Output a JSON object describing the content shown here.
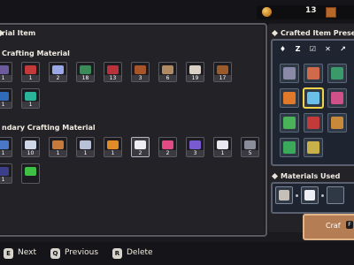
{
  "header": {
    "gold_amount": "13",
    "coin_icon": "gold-coin-icon",
    "chest_icon": "chest-icon"
  },
  "left_panel": {
    "title": "rial Item",
    "sections": [
      {
        "title": "Crafting Material",
        "rows": [
          [
            {
              "icon": "scroll-icon",
              "color": "#6c5a9c",
              "count": "1"
            },
            {
              "icon": "red-gem-icon",
              "color": "#c23a3a",
              "count": "1"
            },
            {
              "icon": "diamond-icon",
              "color": "#9aa8e8",
              "count": "2"
            },
            {
              "icon": "green-herb-icon",
              "color": "#3c8a5a",
              "count": "18"
            },
            {
              "icon": "red-crystal-icon",
              "color": "#b8323c",
              "count": "13"
            },
            {
              "icon": "spider-icon",
              "color": "#a9552a",
              "count": "3"
            },
            {
              "icon": "mushroom-icon",
              "color": "#b08a63",
              "count": "6"
            },
            {
              "icon": "bandage-icon",
              "color": "#d9d1c6",
              "count": "19"
            },
            {
              "icon": "log-icon",
              "color": "#9a5a2a",
              "count": "17"
            }
          ],
          [
            {
              "icon": "blue-flask-icon",
              "color": "#2f6bb8",
              "count": "1"
            },
            {
              "icon": "teal-potion-icon",
              "color": "#2ab59a",
              "count": "1"
            }
          ]
        ]
      },
      {
        "title": "ndary Crafting Material",
        "rows": [
          [
            {
              "icon": "blue-scale-icon",
              "color": "#4a78c9",
              "count": "1"
            },
            {
              "icon": "feather-icon",
              "color": "#cfd6e6",
              "count": "10"
            },
            {
              "icon": "hourglass-icon",
              "color": "#c77a3a",
              "count": "1"
            },
            {
              "icon": "shield-fragment-icon",
              "color": "#b7c2d6",
              "count": "1"
            },
            {
              "icon": "ankh-icon",
              "color": "#e08a2a",
              "count": "1"
            },
            {
              "icon": "white-crystal-icon",
              "color": "#f0eef5",
              "count": "2"
            },
            {
              "icon": "pink-vial-icon",
              "color": "#e24a86",
              "count": "2"
            },
            {
              "icon": "purple-cube-icon",
              "color": "#7a5ad1",
              "count": "3"
            },
            {
              "icon": "quill-icon",
              "color": "#e8e6ef",
              "count": "1"
            },
            {
              "icon": "book-icon",
              "color": "#8a8d99",
              "count": "5"
            }
          ],
          [
            {
              "icon": "dark-vial-icon",
              "color": "#3b3f8a",
              "count": "1"
            },
            {
              "icon": "green-plant-icon",
              "color": "#3fbf46",
              "count": ""
            }
          ]
        ]
      }
    ]
  },
  "right_panel": {
    "preset_title": "Crafted Item Preset",
    "tabs": [
      "♦",
      "Z",
      "☑",
      "✕",
      "↗"
    ],
    "preset_items": [
      {
        "icon": "dark-sword-icon",
        "color": "#8a8aa8",
        "selected": false
      },
      {
        "icon": "wand-icon",
        "color": "#d06a4a",
        "selected": false
      },
      {
        "icon": "green-blade-icon",
        "color": "#3a9a6a",
        "selected": false
      },
      {
        "icon": "fire-staff-icon",
        "color": "#e07a2a",
        "selected": false
      },
      {
        "icon": "ice-sword-icon",
        "color": "#6ac0e8",
        "selected": true
      },
      {
        "icon": "pink-dagger-icon",
        "color": "#d0508a",
        "selected": false
      },
      {
        "icon": "leaf-blade-icon",
        "color": "#4ab35a",
        "selected": false
      },
      {
        "icon": "crimson-sword-icon",
        "color": "#c23a3a",
        "selected": false
      },
      {
        "icon": "bronze-axe-icon",
        "color": "#c88a3a",
        "selected": false
      },
      {
        "icon": "green-spear-icon",
        "color": "#3aaa5a",
        "selected": false
      },
      {
        "icon": "gold-shield-icon",
        "color": "#c8b04a",
        "selected": false
      }
    ],
    "materials_title": "Materials Used",
    "materials": [
      {
        "icon": "mushroom-icon",
        "color": "#c6c0b8"
      },
      {
        "icon": "white-crystal-icon",
        "color": "#f0eef5"
      },
      {
        "icon": "empty-slot-icon",
        "color": "#2f3845"
      }
    ],
    "craft_label": "Craf",
    "craft_key": "F"
  },
  "footer": {
    "hints": [
      {
        "key": "E",
        "label": "Next"
      },
      {
        "key": "Q",
        "label": "Previous"
      },
      {
        "key": "R",
        "label": "Delete"
      }
    ]
  }
}
